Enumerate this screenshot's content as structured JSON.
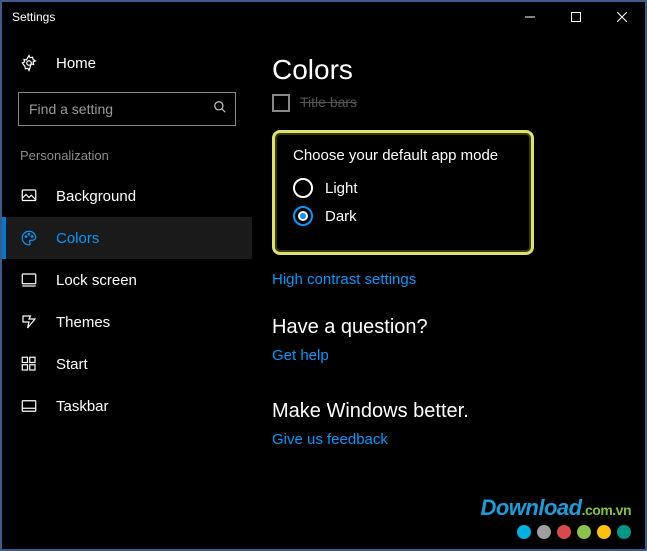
{
  "titlebar": {
    "title": "Settings"
  },
  "home_label": "Home",
  "search": {
    "placeholder": "Find a setting"
  },
  "category": "Personalization",
  "nav": [
    {
      "label": "Background"
    },
    {
      "label": "Colors"
    },
    {
      "label": "Lock screen"
    },
    {
      "label": "Themes"
    },
    {
      "label": "Start"
    },
    {
      "label": "Taskbar"
    }
  ],
  "page": {
    "title": "Colors",
    "partial_checkbox_label": "Title bars",
    "app_mode": {
      "heading": "Choose your default app mode",
      "option_light": "Light",
      "option_dark": "Dark",
      "selected": "Dark"
    },
    "link_high_contrast": "High contrast settings",
    "question_heading": "Have a question?",
    "link_get_help": "Get help",
    "better_heading": "Make Windows better.",
    "link_feedback": "Give us feedback"
  },
  "watermark": {
    "brand_main": "Download",
    "brand_domain": ".com.vn",
    "dots": [
      "#00b0e0",
      "#9e9e9e",
      "#d84a4a",
      "#8bc34a",
      "#ffc107",
      "#009688"
    ]
  }
}
